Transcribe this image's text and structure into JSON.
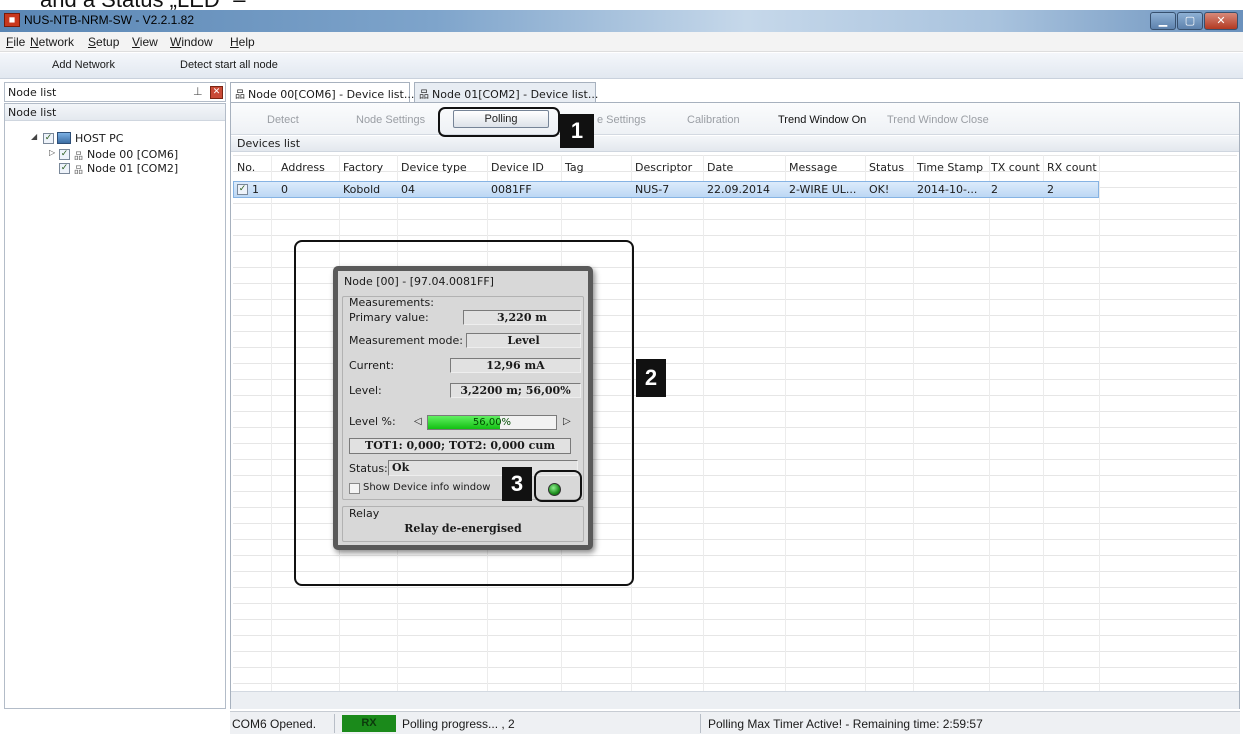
{
  "caption": "and a Status „LED“ –",
  "window": {
    "title": "NUS-NTB-NRM-SW - V2.2.1.82"
  },
  "menu": [
    "File",
    "Network",
    "Setup",
    "View",
    "Window",
    "Help"
  ],
  "toolbar": {
    "add_network": "Add Network",
    "detect_start": "Detect start all node"
  },
  "left_panel": {
    "header": "Node list",
    "title": "Node list",
    "tree": {
      "root": "HOST PC",
      "nodes": [
        "Node 00 [COM6]",
        "Node 01 [COM2]"
      ]
    }
  },
  "tabs": [
    "Node 00[COM6] - Device list...",
    "Node 01[COM2] - Device list..."
  ],
  "sub_toolbar": {
    "detect": "Detect",
    "node_settings": "Node Settings",
    "polling": "Polling",
    "settings": "e Settings",
    "calibration": "Calibration",
    "trend_on": "Trend Window On",
    "trend_close": "Trend Window Close"
  },
  "devices_label": "Devices list",
  "table": {
    "headers": [
      "No.",
      "Address",
      "Factory",
      "Device type",
      "Device ID",
      "Tag",
      "Descriptor",
      "Date",
      "Message",
      "Status",
      "Time Stamp",
      "TX count",
      "RX count"
    ],
    "row": [
      "1",
      "0",
      "Kobold",
      "04",
      "0081FF",
      "",
      "NUS-7",
      "22.09.2014",
      "2-WIRE UL...",
      "OK!",
      "2014-10-...",
      "2",
      "2"
    ]
  },
  "dialog": {
    "title": "Node [00] - [97.04.0081FF]",
    "measurements_title": "Measurements:",
    "primary_label": "Primary value:",
    "primary_value": "3,220 m",
    "mode_label": "Measurement mode:",
    "mode_value": "Level",
    "current_label": "Current:",
    "current_value": "12,96 mA",
    "level_label": "Level:",
    "level_value": "3,2200 m; 56,00%",
    "level_pct_label": "Level %:",
    "level_pct_text": "56,00%",
    "level_pct": 56.0,
    "totals": "TOT1: 0,000; TOT2: 0,000 cum",
    "status_label": "Status:",
    "status_value": "Ok",
    "show_info": "Show Device info window",
    "relay_title": "Relay",
    "relay_value": "Relay de-energised",
    "led_color": "#1d8d1d"
  },
  "status_bar": {
    "port": "COM6 Opened.",
    "rx": "RX",
    "progress": "Polling progress... , 2",
    "timer": "Polling Max Timer Active! - Remaining time: 2:59:57"
  },
  "annotations": [
    "1",
    "2",
    "3"
  ]
}
